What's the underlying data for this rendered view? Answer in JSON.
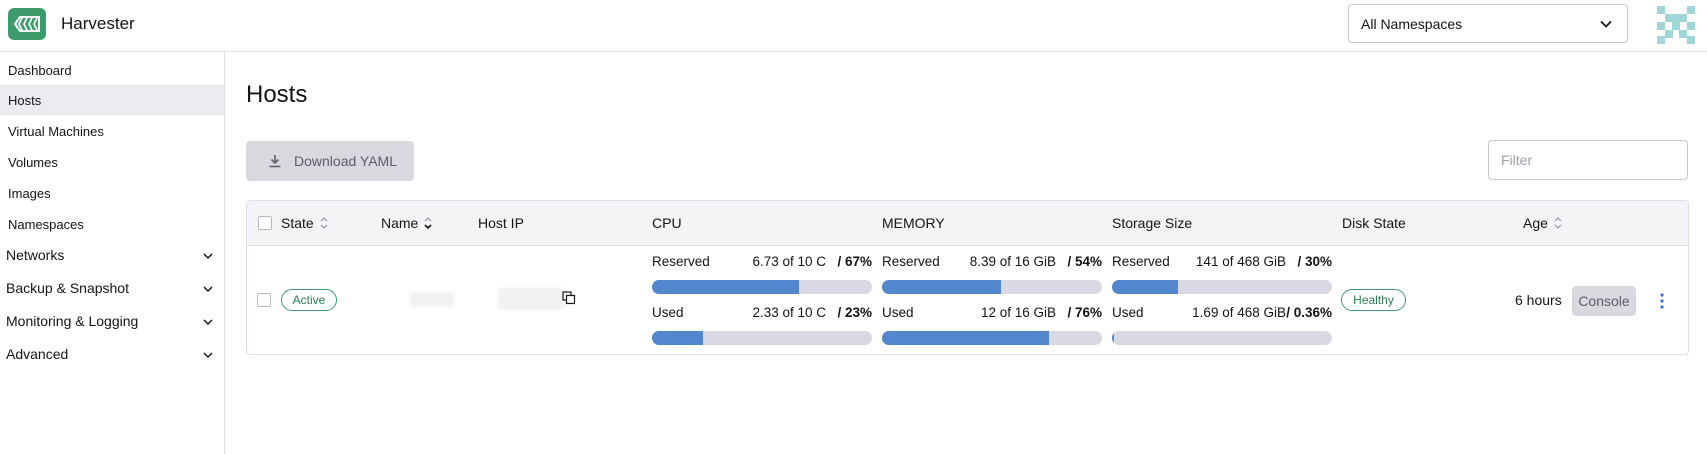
{
  "app": {
    "title": "Harvester"
  },
  "namespace_select": {
    "value": "All Namespaces"
  },
  "sidebar": {
    "items": [
      {
        "label": "Dashboard"
      },
      {
        "label": "Hosts"
      },
      {
        "label": "Virtual Machines"
      },
      {
        "label": "Volumes"
      },
      {
        "label": "Images"
      },
      {
        "label": "Namespaces"
      }
    ],
    "groups": [
      {
        "label": "Networks"
      },
      {
        "label": "Backup & Snapshot"
      },
      {
        "label": "Monitoring & Logging"
      },
      {
        "label": "Advanced"
      }
    ]
  },
  "page": {
    "title": "Hosts"
  },
  "toolbar": {
    "download_label": "Download YAML",
    "filter_placeholder": "Filter"
  },
  "table": {
    "headers": {
      "state": "State",
      "name": "Name",
      "host_ip": "Host IP",
      "cpu": "CPU",
      "memory": "MEMORY",
      "storage": "Storage Size",
      "disk_state": "Disk State",
      "age": "Age"
    },
    "row": {
      "state": "Active",
      "cpu": {
        "reserved": {
          "label": "Reserved",
          "value": "6.73 of 10 C",
          "pct": "/ 67%",
          "fraction": 0.67
        },
        "used": {
          "label": "Used",
          "value": "2.33 of 10 C",
          "pct": "/ 23%",
          "fraction": 0.23
        }
      },
      "memory": {
        "reserved": {
          "label": "Reserved",
          "value": "8.39 of 16 GiB",
          "pct": "/ 54%",
          "fraction": 0.54
        },
        "used": {
          "label": "Used",
          "value": "12 of 16 GiB",
          "pct": "/ 76%",
          "fraction": 0.76
        }
      },
      "storage": {
        "reserved": {
          "label": "Reserved",
          "value": "141 of 468 GiB",
          "pct": "/ 30%",
          "fraction": 0.3
        },
        "used": {
          "label": "Used",
          "value": "1.69 of 468 GiB",
          "pct": "/ 0.36%",
          "fraction": 0.0036
        }
      },
      "disk_state": "Healthy",
      "age": "6 hours",
      "console_label": "Console"
    }
  },
  "colors": {
    "brand": "#3d9a6b",
    "bar_fill": "#5286cd",
    "bar_track": "#d8d9e2"
  }
}
